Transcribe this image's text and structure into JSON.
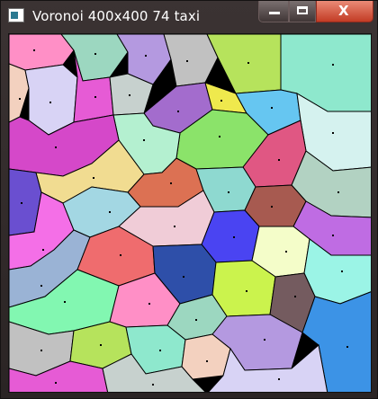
{
  "window": {
    "title": "Voronoi 400x400 74 taxi",
    "icon": "app-icon"
  },
  "caption": {
    "minimize_icon": "minimize-icon",
    "maximize_icon": "maximize-icon",
    "close_label": "X"
  },
  "canvas": {
    "background": "#000000",
    "cell_colors": [
      "#ff8fc6",
      "#9cd7c0",
      "#b499e0",
      "#c1c1c1",
      "#b6e35c",
      "#8ee8cd",
      "#f3d1bf",
      "#d8d3f5",
      "#e65bd5",
      "#c7d1ce",
      "#a36ccd",
      "#efe94d",
      "#66c6f1",
      "#d5f2ef",
      "#8be36a",
      "#b4f0d0",
      "#e05783",
      "#b2d2c2",
      "#d548c9",
      "#6a4fd0",
      "#f1dc91",
      "#dc7153",
      "#8ed9d0",
      "#a75a50",
      "#bf6ce3",
      "#f46fe7",
      "#a3d7e3",
      "#f0ccd7",
      "#4a44f2",
      "#f4fdc9",
      "#9bf4e6",
      "#9ab3d5",
      "#ef6c6e",
      "#2e4fa9",
      "#cbf34d",
      "#745b5f",
      "#3c93e6",
      "#82f7b1"
    ]
  }
}
